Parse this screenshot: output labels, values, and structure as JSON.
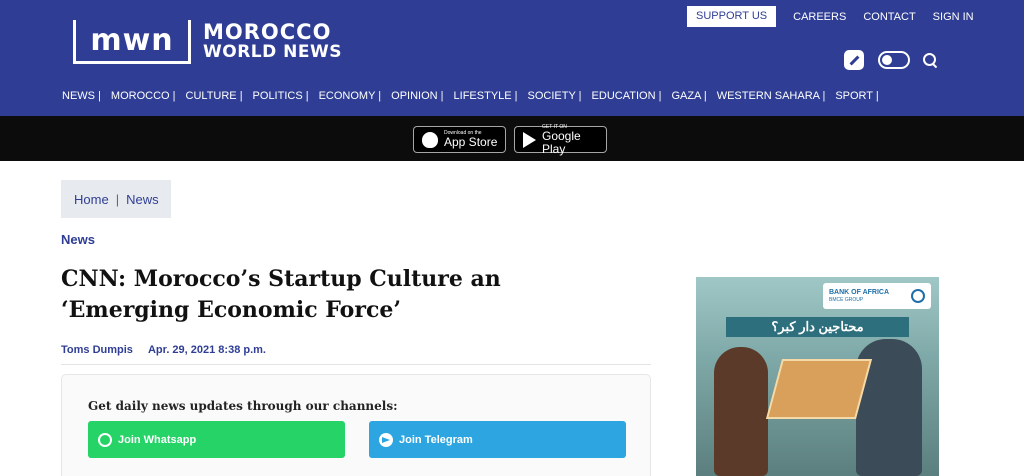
{
  "header": {
    "logo_mark": "mwn",
    "logo_line1": "MOROCCO",
    "logo_line2": "WORLD NEWS",
    "top_links": {
      "support": "SUPPORT US",
      "careers": "CAREERS",
      "contact": "CONTACT",
      "signin": "SIGN IN"
    },
    "nav": [
      "NEWS |",
      "MOROCCO |",
      "CULTURE |",
      "POLITICS |",
      "ECONOMY |",
      "OPINION |",
      "LIFESTYLE |",
      "SOCIETY |",
      "EDUCATION |",
      "GAZA |",
      "WESTERN SAHARA |",
      "SPORT |"
    ],
    "icons": [
      "pen-icon",
      "theme-toggle",
      "search-icon"
    ]
  },
  "app_band": {
    "appstore_small": "Download on the",
    "appstore_big": "App Store",
    "googleplay_small": "GET IT ON",
    "googleplay_big": "Google Play"
  },
  "breadcrumb": {
    "home": "Home",
    "separator": "|",
    "current": "News"
  },
  "article": {
    "category": "News",
    "title": "CNN: Morocco’s Startup Culture an ‘Emerging Economic Force’",
    "author": "Toms Dumpis",
    "date": "Apr. 29, 2021 8:38 p.m."
  },
  "channels": {
    "title": "Get daily news updates through our channels:",
    "whatsapp": "Join Whatsapp",
    "telegram": "Join Telegram"
  },
  "ad": {
    "bank_name": "BANK OF AFRICA",
    "bank_sub": "BMCE GROUP",
    "headline": "محتاجين دار كبر؟"
  },
  "colors": {
    "header_bg": "#2f3e94",
    "app_band_bg": "#0c0c0c",
    "whatsapp": "#25d366",
    "telegram": "#2ca5e0",
    "link": "#2f3e94"
  }
}
